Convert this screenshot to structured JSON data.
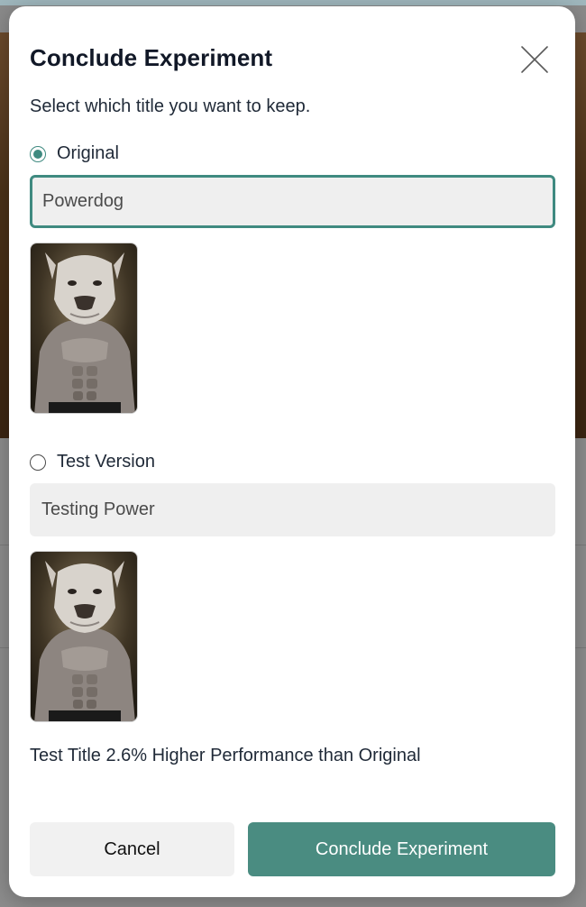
{
  "modal": {
    "title": "Conclude Experiment",
    "subtitle": "Select which title you want to keep."
  },
  "options": [
    {
      "label": "Original",
      "value": "Powerdog",
      "selected": true,
      "thumbnail": "muscular-dog-image"
    },
    {
      "label": "Test Version",
      "value": "Testing Power",
      "selected": false,
      "thumbnail": "muscular-dog-image"
    }
  ],
  "result": {
    "text": "Test Title 2.6% Higher Performance than Original"
  },
  "actions": {
    "cancel_label": "Cancel",
    "conclude_label": "Conclude Experiment"
  },
  "colors": {
    "accent": "#4a8c81",
    "title": "#111827"
  },
  "icons": {
    "close": "close-icon"
  }
}
